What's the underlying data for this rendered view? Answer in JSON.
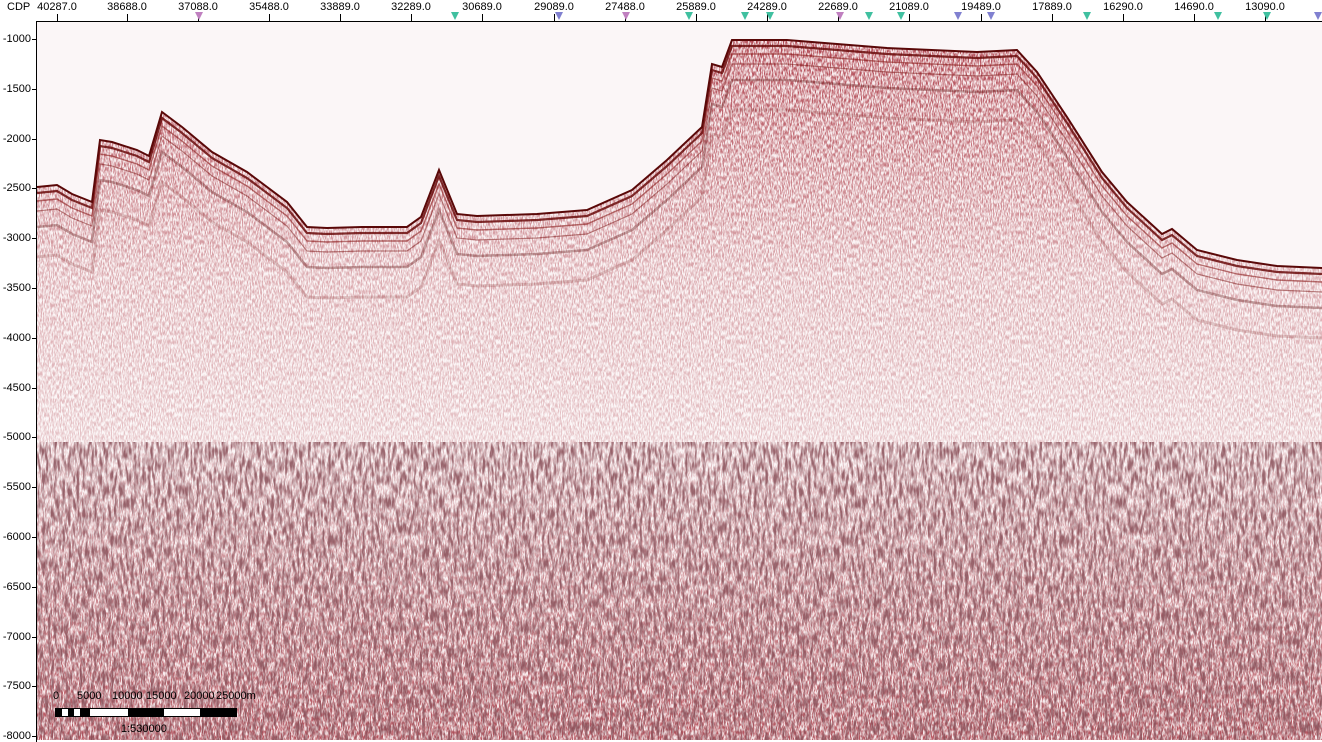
{
  "top_axis": {
    "title": "CDP",
    "labels": [
      "40287.0",
      "38688.0",
      "37088.0",
      "35488.0",
      "33889.0",
      "32289.0",
      "30689.0",
      "29089.0",
      "27488.0",
      "25889.0",
      "24289.0",
      "22689.0",
      "21089.0",
      "19489.0",
      "17889.0",
      "16290.0",
      "14690.0",
      "13090.0"
    ],
    "markers": [
      {
        "type": "well-marker",
        "color": "#c080c0"
      },
      {
        "type": "well-marker",
        "color": "#40c0a0"
      },
      {
        "type": "well-marker",
        "color": "#8080d0"
      },
      {
        "type": "well-marker",
        "color": "#c080c0"
      },
      {
        "type": "well-marker",
        "color": "#40c0a0"
      },
      {
        "type": "well-marker",
        "color": "#40c0a0"
      },
      {
        "type": "well-marker",
        "color": "#40c0a0"
      },
      {
        "type": "well-marker",
        "color": "#c080c0"
      },
      {
        "type": "well-marker",
        "color": "#40c0a0"
      },
      {
        "type": "well-marker",
        "color": "#40c0a0"
      },
      {
        "type": "well-marker",
        "color": "#8080d0"
      },
      {
        "type": "well-marker",
        "color": "#8080d0"
      },
      {
        "type": "well-marker",
        "color": "#40c0a0"
      },
      {
        "type": "well-marker",
        "color": "#40c0a0"
      },
      {
        "type": "well-marker",
        "color": "#40c0a0"
      },
      {
        "type": "well-marker",
        "color": "#8080d0"
      }
    ]
  },
  "left_axis": {
    "labels": [
      "-1000",
      "-1500",
      "-2000",
      "-2500",
      "-3000",
      "-3500",
      "-4000",
      "-4500",
      "-5000",
      "-5500",
      "-6000",
      "-6500",
      "-7000",
      "-7500",
      "-8000"
    ]
  },
  "scale_bar": {
    "labels": [
      "0",
      "5000",
      "10000",
      "15000",
      "20000",
      "25000m"
    ],
    "ratio": "1:530000"
  },
  "colors": {
    "positive_amplitude": "#7a0000",
    "negative_amplitude": "#2a2a2a",
    "background": "#fbf6f7",
    "marker_pink": "#c080c0",
    "marker_teal": "#40c0a0",
    "marker_blue": "#8080d0"
  }
}
